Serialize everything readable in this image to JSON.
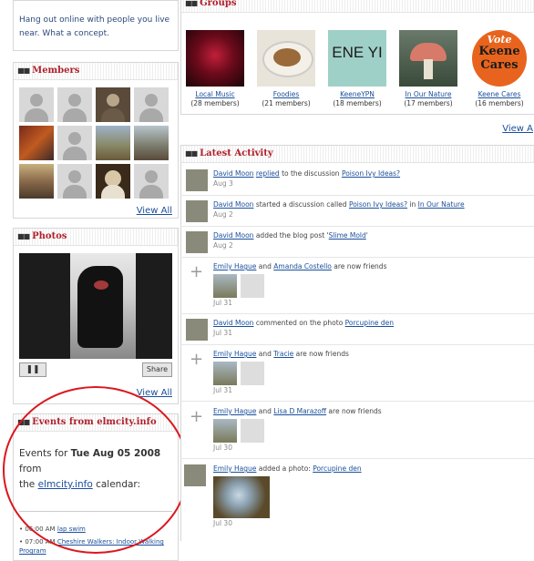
{
  "intro_text": "Hang out online with people you live near. What a concept.",
  "members": {
    "title": "Members",
    "view_all": "View All"
  },
  "photos": {
    "title": "Photos",
    "view_all": "View All",
    "share_label": "Share",
    "pause_label": "❚❚"
  },
  "events": {
    "title": "Events from elmcity.info",
    "line1_prefix": "Events for ",
    "date": "Tue Aug 05 2008",
    "line1_suffix": " from",
    "line2_prefix": "the ",
    "link": "elmcity.info",
    "line2_suffix": " calendar:",
    "items": [
      {
        "time": "• 06:00 AM ",
        "title": "lap swim"
      },
      {
        "time": "• 07:00 AM ",
        "title": "Cheshire Walkers: Indoor Walking Program"
      }
    ]
  },
  "groups": {
    "title": "Groups",
    "view_all": "View A",
    "items": [
      {
        "name": "Local Music",
        "count": "(28 members)"
      },
      {
        "name": "Foodies",
        "count": "(21 members)"
      },
      {
        "name": "KeeneYPN",
        "count": "(18 members)",
        "thumb_text": "ENE YI"
      },
      {
        "name": "In Our Nature",
        "count": "(17 members)"
      },
      {
        "name": "Keene Cares",
        "count": "(16 members)",
        "thumb_text_1": "Vote",
        "thumb_text_2": "Keene",
        "thumb_text_3": "Cares"
      }
    ]
  },
  "activity": {
    "title": "Latest Activity",
    "items": [
      {
        "a": "David Moon",
        "m1": " ",
        "l1": "replied",
        "m2": " to the discussion ",
        "l2": "Poison Ivy Ideas?",
        "date": "Aug 3"
      },
      {
        "a": "David Moon",
        "m1": " started a discussion called ",
        "l1": "Poison Ivy Ideas?",
        "m2": " in ",
        "l2": "In Our Nature",
        "date": "Aug 2"
      },
      {
        "a": "David Moon",
        "m1": " added the blog post '",
        "l1": "Slime Mold",
        "m2": "'",
        "date": "Aug 2"
      },
      {
        "a": "Emily Hague",
        "m1": " and ",
        "l1": "Amanda Costello",
        "m2": " are now friends",
        "date": "Jul 31"
      },
      {
        "a": "David Moon",
        "m1": " commented on the photo ",
        "l1": "Porcupine den",
        "date": "Jul 31"
      },
      {
        "a": "Emily Hague",
        "m1": " and ",
        "l1": "Tracie",
        "m2": " are now friends",
        "date": "Jul 31"
      },
      {
        "a": "Emily Hague",
        "m1": " and ",
        "l1": "Lisa D Marazoff",
        "m2": " are now friends",
        "date": "Jul 30"
      },
      {
        "a": "Emily Hague",
        "m1": " added a photo: ",
        "l1": "Porcupine den",
        "date": "Jul 30"
      }
    ]
  },
  "colors": {
    "header_red": "#b0202b",
    "link_blue": "#1a4f9c",
    "circle_red": "#d9181f"
  }
}
